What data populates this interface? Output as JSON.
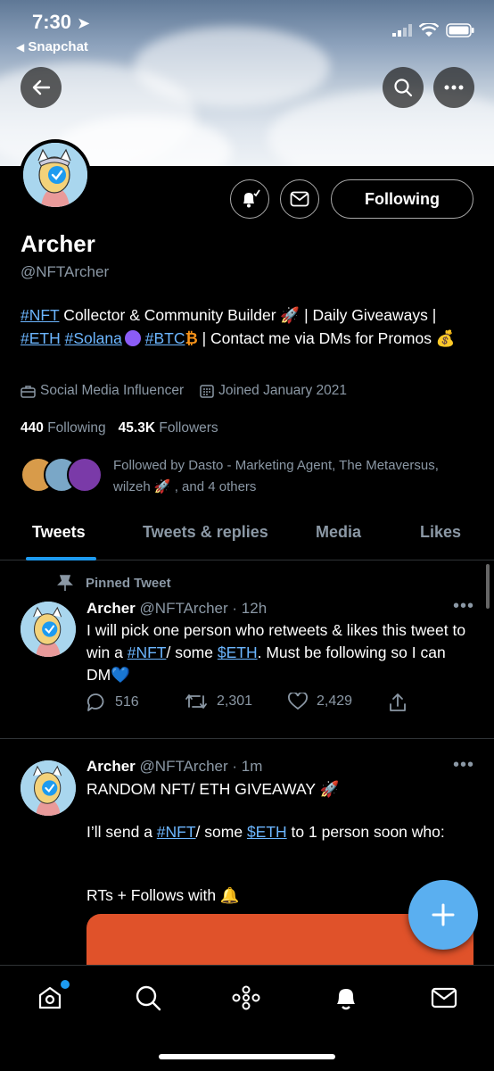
{
  "status_bar": {
    "time": "7:30",
    "back_app": "Snapchat"
  },
  "profile": {
    "name": "Archer",
    "handle": "@NFTArcher",
    "follow_button": "Following",
    "bio": {
      "tag_nft": "#NFT",
      "text1": " Collector & Community Builder 🚀 | Daily Giveaways | ",
      "tag_eth": "#ETH",
      "tag_solana": "#Solana",
      "tag_btc": "#BTC",
      "text2": " | Contact me via DMs for Promos 💰"
    },
    "category": "Social Media Influencer",
    "joined": "Joined January 2021",
    "following_count": "440",
    "following_label": "Following",
    "followers_count": "45.3K",
    "followers_label": "Followers",
    "followed_by": "Followed by Dasto - Marketing Agent, The Metaversus, wilzeh 🚀 , and 4 others"
  },
  "tabs": [
    "Tweets",
    "Tweets & replies",
    "Media",
    "Likes"
  ],
  "tweets": [
    {
      "pinned_label": "Pinned Tweet",
      "name": "Archer",
      "handle": "@NFTArcher",
      "time": "· 12h",
      "text_a": "I will pick one person who retweets & likes this tweet to win a ",
      "tag1": "#NFT",
      "text_b": "/ some ",
      "tag2": "$ETH",
      "text_c": ". Must be following so I can DM💙",
      "replies": "516",
      "retweets": "2,301",
      "likes": "2,429"
    },
    {
      "name": "Archer",
      "handle": "@NFTArcher",
      "time": "· 1m",
      "line1": "RANDOM NFT/ ETH GIVEAWAY 🚀",
      "text_a": "I’ll send a ",
      "tag1": "#NFT",
      "text_b": "/ some ",
      "tag2": "$ETH",
      "text_c": " to 1 person soon who:",
      "line3": "RTs + Follows with 🔔"
    }
  ],
  "colors": {
    "accent": "#1d9bf0",
    "hashtag": "#6cb6ff",
    "fab": "#5aaff0",
    "muted": "#8b98a5"
  }
}
